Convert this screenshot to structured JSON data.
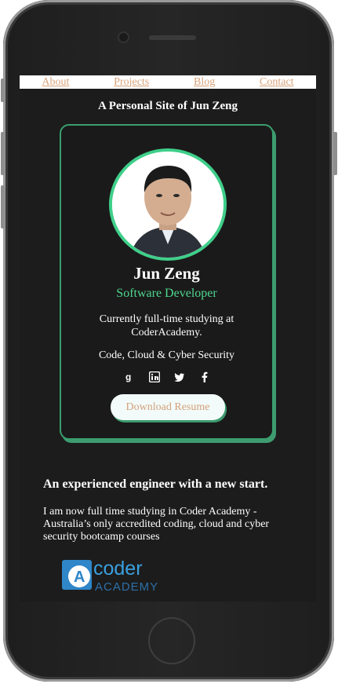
{
  "nav": {
    "items": [
      {
        "label": "About"
      },
      {
        "label": "Projects"
      },
      {
        "label": "Blog"
      },
      {
        "label": "Contact"
      }
    ]
  },
  "site": {
    "title": "A Personal Site of Jun Zeng"
  },
  "profile": {
    "name": "Jun Zeng",
    "role": "Software Developer",
    "status": "Currently full-time studying at CoderAcademy.",
    "focus": "Code, Cloud & Cyber Security",
    "resume_label": "Download Resume",
    "socials": [
      "github-icon",
      "linkedin-icon",
      "twitter-icon",
      "facebook-icon"
    ]
  },
  "about": {
    "headline": "An experienced engineer with a new start.",
    "paragraph": "I am now full time studying in Coder Academy - Australia’s only accredited coding, cloud and cyber security bootcamp courses"
  },
  "logo": {
    "letter": "A",
    "word_top": "coder",
    "word_bottom": "ACADEMY"
  },
  "colors": {
    "accent": "#3fcf8a",
    "nav_link": "#d9a37a",
    "background": "#1c1c1c",
    "logo_blue": "#2f86c8"
  }
}
